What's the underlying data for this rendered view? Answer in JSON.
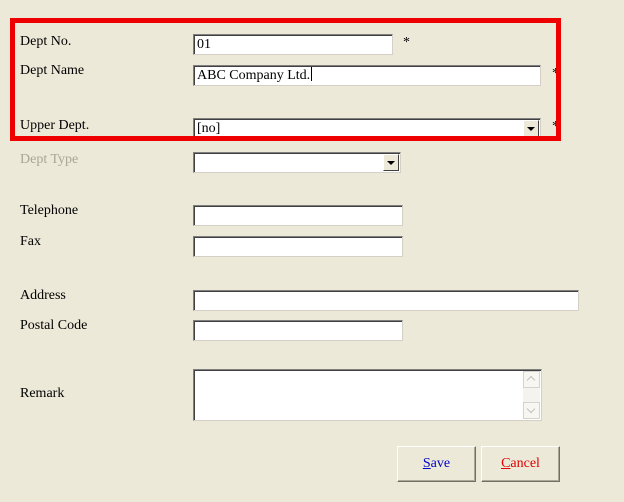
{
  "form": {
    "dept_no": {
      "label": "Dept No.",
      "value": "01",
      "required_mark": "*"
    },
    "dept_name": {
      "label": "Dept Name",
      "value": "ABC Company Ltd.",
      "required_mark": "*"
    },
    "upper_dept": {
      "label": "Upper Dept.",
      "value": "[no]",
      "required_mark": "*"
    },
    "dept_type": {
      "label": "Dept Type",
      "value": ""
    },
    "telephone": {
      "label": "Telephone",
      "value": ""
    },
    "fax": {
      "label": "Fax",
      "value": ""
    },
    "address": {
      "label": "Address",
      "value": ""
    },
    "postal_code": {
      "label": "Postal Code",
      "value": ""
    },
    "remark": {
      "label": "Remark",
      "value": ""
    }
  },
  "buttons": {
    "save": {
      "accel": "S",
      "rest": "ave"
    },
    "cancel": {
      "accel": "C",
      "rest": "ancel"
    }
  },
  "colors": {
    "background": "#ece9d8",
    "highlight_border": "#ee0000",
    "disabled_label": "#a7a697",
    "save_text": "#0000cc",
    "cancel_text": "#dd0000"
  }
}
